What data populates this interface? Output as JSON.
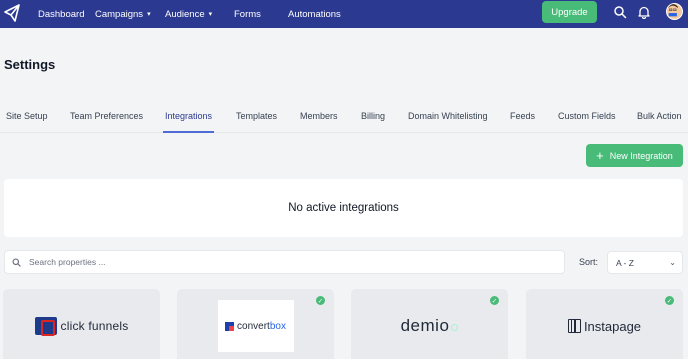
{
  "nav": {
    "items": [
      {
        "label": "Dashboard",
        "has_dropdown": false
      },
      {
        "label": "Campaigns",
        "has_dropdown": true
      },
      {
        "label": "Audience",
        "has_dropdown": true
      },
      {
        "label": "Forms",
        "has_dropdown": false
      },
      {
        "label": "Automations",
        "has_dropdown": false
      }
    ],
    "upgrade_label": "Upgrade",
    "bg_color": "#2b3990",
    "accent_color": "#48bb78"
  },
  "page": {
    "title": "Settings"
  },
  "tabs": [
    {
      "label": "Site Setup",
      "active": false
    },
    {
      "label": "Team Preferences",
      "active": false
    },
    {
      "label": "Integrations",
      "active": true
    },
    {
      "label": "Templates",
      "active": false
    },
    {
      "label": "Members",
      "active": false
    },
    {
      "label": "Billing",
      "active": false
    },
    {
      "label": "Domain Whitelisting",
      "active": false
    },
    {
      "label": "Feeds",
      "active": false
    },
    {
      "label": "Custom Fields",
      "active": false
    },
    {
      "label": "Bulk Action",
      "active": false
    }
  ],
  "new_integration_label": "New Integration",
  "empty_state": "No active integrations",
  "search": {
    "placeholder": "Search properties ..."
  },
  "sort": {
    "label": "Sort:",
    "value": "A - Z"
  },
  "integrations": [
    {
      "name": "click funnels",
      "logo_icon": "clickfunnels-logo",
      "connected": false
    },
    {
      "name": "convertbox",
      "logo_parts": [
        "convert",
        "box"
      ],
      "logo_icon": "convertbox-logo",
      "connected": true
    },
    {
      "name": "demio",
      "logo_icon": "demio-logo",
      "connected": true
    },
    {
      "name": "Instapage",
      "logo_icon": "instapage-logo",
      "connected": true
    }
  ]
}
